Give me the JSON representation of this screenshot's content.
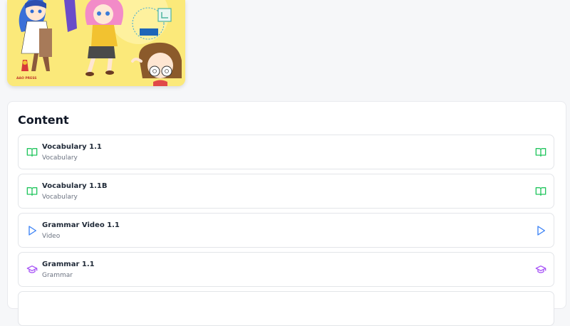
{
  "cover": {
    "publisher_mark": "AAO PRESS"
  },
  "content": {
    "title": "Content",
    "items": [
      {
        "name": "Vocabulary 1.1",
        "type": "Vocabulary",
        "icon": "book-open-icon",
        "color": "#22c55e"
      },
      {
        "name": "Vocabulary 1.1B",
        "type": "Vocabulary",
        "icon": "book-open-icon",
        "color": "#22c55e"
      },
      {
        "name": "Grammar Video 1.1",
        "type": "Video",
        "icon": "play-icon",
        "color": "#3b82f6"
      },
      {
        "name": "Grammar 1.1",
        "type": "Grammar",
        "icon": "graduation-cap-icon",
        "color": "#a855f7"
      }
    ]
  }
}
